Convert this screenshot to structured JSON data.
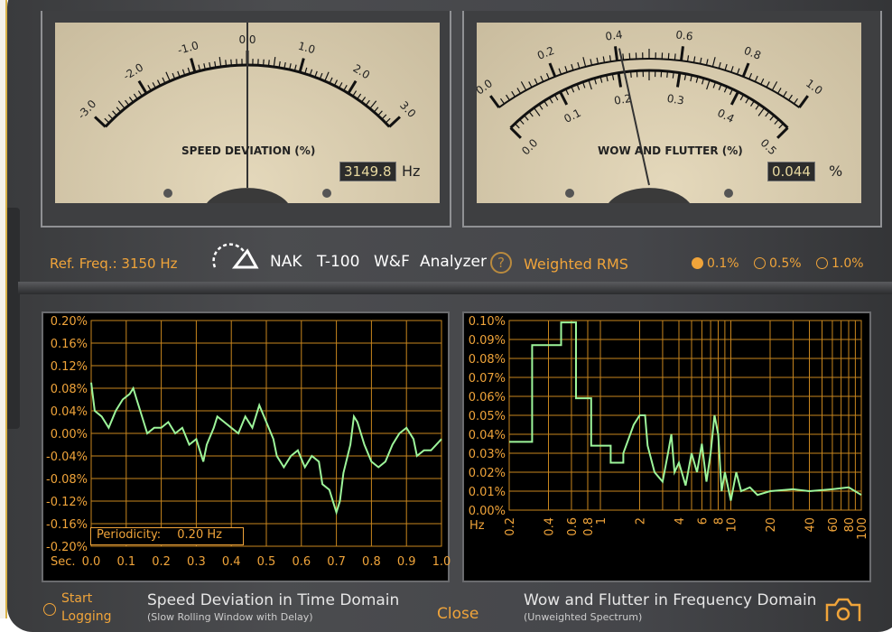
{
  "meters": {
    "speed": {
      "title": "SPEED DEVIATION (%)",
      "labels": [
        "-3.0",
        "-2.0",
        "-1.0",
        "0.0",
        "1.0",
        "2.0",
        "3.0"
      ],
      "needle_value": 0.0,
      "readout": "3149.8",
      "unit": "Hz"
    },
    "wow": {
      "title": "WOW AND FLUTTER (%)",
      "outer_labels": [
        "0.0",
        "0.2",
        "0.4",
        "0.6",
        "0.8",
        "1.0"
      ],
      "inner_labels": [
        "0.0",
        "0.1",
        "0.2",
        "0.3",
        "0.4",
        "0.5"
      ],
      "needle_fraction": 0.44,
      "readout": "0.044",
      "unit": "%"
    }
  },
  "controls": {
    "ref_freq": "Ref. Freq.: 3150 Hz",
    "brand": "NAK",
    "model": "T-100",
    "wf": "W&F",
    "analyzer": "Analyzer",
    "help": "?",
    "mode": "Weighted RMS",
    "ranges": [
      {
        "label": "0.1%",
        "selected": true
      },
      {
        "label": "0.5%",
        "selected": false
      },
      {
        "label": "1.0%",
        "selected": false
      }
    ]
  },
  "bottom": {
    "start": "Start",
    "logging": "Logging",
    "close": "Close",
    "left_title": "Speed Deviation in Time Domain",
    "left_sub": "(Slow Rolling Window with Delay)",
    "right_title": "Wow and Flutter in Frequency Domain",
    "right_sub": "(Unweighted Spectrum)"
  },
  "periodicity": {
    "label": "Periodicity:",
    "value": "0.20 Hz"
  },
  "colors": {
    "accent": "#f0a43a",
    "trace": "#9df59a",
    "grid": "#c8861e"
  },
  "chart_data": [
    {
      "type": "line",
      "title": "Speed Deviation in Time Domain",
      "xlabel": "Sec.",
      "xlim": [
        0,
        1
      ],
      "ylim": [
        -0.2,
        0.2
      ],
      "xticks": [
        "0.0",
        "0.1",
        "0.2",
        "0.3",
        "0.4",
        "0.5",
        "0.6",
        "0.7",
        "0.8",
        "0.9",
        "1.0"
      ],
      "yticks": [
        "0.20%",
        "0.16%",
        "0.12%",
        "0.08%",
        "0.04%",
        "0.00%",
        "-0.04%",
        "-0.08%",
        "-0.12%",
        "-0.16%",
        "-0.20%"
      ],
      "x": [
        0,
        0.01,
        0.03,
        0.05,
        0.07,
        0.09,
        0.11,
        0.12,
        0.13,
        0.14,
        0.15,
        0.16,
        0.18,
        0.2,
        0.22,
        0.24,
        0.26,
        0.28,
        0.3,
        0.31,
        0.32,
        0.33,
        0.35,
        0.36,
        0.38,
        0.4,
        0.42,
        0.44,
        0.46,
        0.48,
        0.5,
        0.52,
        0.53,
        0.55,
        0.57,
        0.59,
        0.61,
        0.63,
        0.65,
        0.66,
        0.68,
        0.7,
        0.71,
        0.72,
        0.74,
        0.75,
        0.76,
        0.78,
        0.8,
        0.82,
        0.84,
        0.86,
        0.88,
        0.9,
        0.92,
        0.93,
        0.95,
        0.97,
        1.0
      ],
      "y": [
        0.09,
        0.04,
        0.03,
        0.01,
        0.04,
        0.06,
        0.07,
        0.08,
        0.06,
        0.04,
        0.02,
        0.0,
        0.01,
        0.01,
        0.02,
        0.0,
        0.01,
        -0.02,
        -0.01,
        -0.03,
        -0.05,
        -0.02,
        0.01,
        0.03,
        0.02,
        0.01,
        0.0,
        0.03,
        0.01,
        0.05,
        0.02,
        -0.01,
        -0.04,
        -0.06,
        -0.04,
        -0.03,
        -0.06,
        -0.04,
        -0.05,
        -0.09,
        -0.1,
        -0.14,
        -0.12,
        -0.07,
        -0.02,
        0.03,
        0.02,
        -0.02,
        -0.05,
        -0.06,
        -0.05,
        -0.02,
        0.0,
        0.01,
        -0.01,
        -0.04,
        -0.03,
        -0.03,
        -0.01
      ]
    },
    {
      "type": "line",
      "title": "Wow and Flutter in Frequency Domain",
      "xlabel": "Hz",
      "xscale": "log",
      "xlim": [
        0.2,
        100
      ],
      "ylim": [
        0,
        0.1
      ],
      "xticks": [
        "0.2",
        "0.4",
        "0.6",
        "0.8",
        "1",
        "2",
        "4",
        "6",
        "8",
        "10",
        "20",
        "40",
        "60",
        "80",
        "100"
      ],
      "yticks": [
        "0.10%",
        "0.09%",
        "0.08%",
        "0.07%",
        "0.06%",
        "0.05%",
        "0.04%",
        "0.03%",
        "0.02%",
        "0.01%",
        "0.00%"
      ],
      "x": [
        0.2,
        0.3,
        0.3,
        0.5,
        0.5,
        0.65,
        0.65,
        0.85,
        0.85,
        1.2,
        1.2,
        1.5,
        1.5,
        1.8,
        2.0,
        2.2,
        2.3,
        2.6,
        3,
        3.3,
        3.5,
        3.7,
        4,
        4.5,
        5,
        5.5,
        6,
        6.5,
        7,
        7.5,
        8,
        8.5,
        9,
        10,
        11,
        12,
        14,
        16,
        20,
        30,
        40,
        60,
        80,
        100
      ],
      "y": [
        0.036,
        0.036,
        0.087,
        0.087,
        0.099,
        0.099,
        0.059,
        0.059,
        0.034,
        0.034,
        0.025,
        0.025,
        0.03,
        0.045,
        0.05,
        0.05,
        0.034,
        0.02,
        0.015,
        0.03,
        0.04,
        0.02,
        0.025,
        0.013,
        0.03,
        0.02,
        0.035,
        0.015,
        0.03,
        0.05,
        0.04,
        0.01,
        0.02,
        0.005,
        0.02,
        0.01,
        0.012,
        0.008,
        0.01,
        0.011,
        0.01,
        0.011,
        0.012,
        0.008
      ]
    }
  ]
}
